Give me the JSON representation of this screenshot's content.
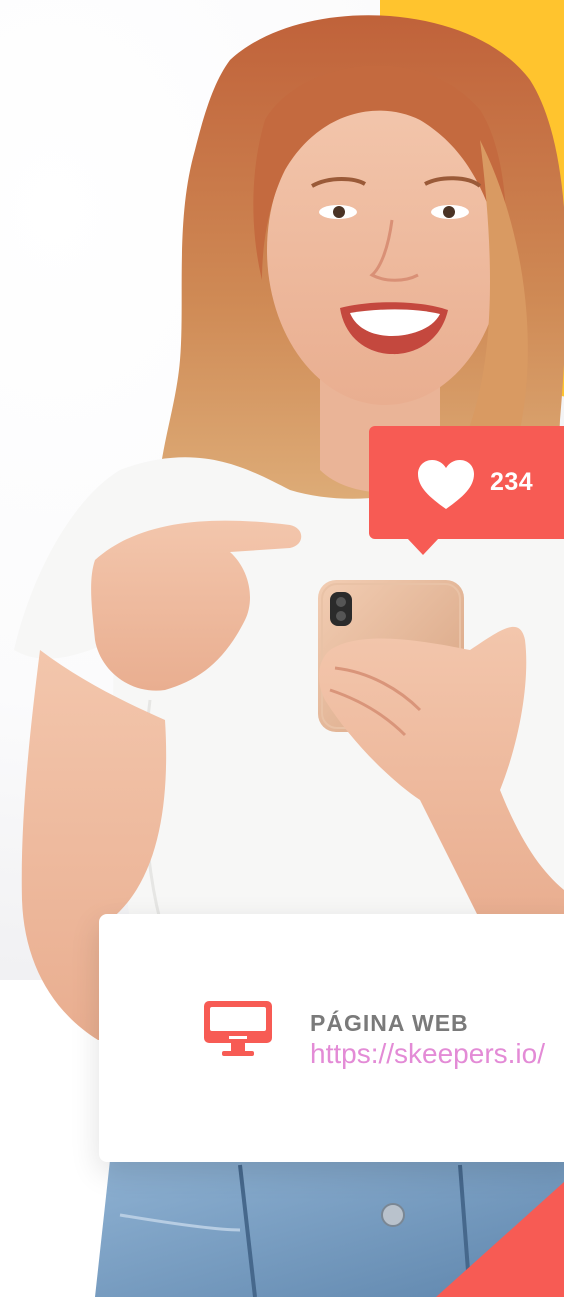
{
  "like_notification": {
    "icon": "heart-icon",
    "count": "234",
    "color": "#f75b54"
  },
  "info_card": {
    "icon": "monitor-icon",
    "label": "PÁGINA WEB",
    "link": "https://skeepers.io/"
  },
  "colors": {
    "accent": "#f75b54",
    "yellow": "#ffc42e",
    "link": "#e38bd6",
    "label": "#7a7a7a"
  }
}
